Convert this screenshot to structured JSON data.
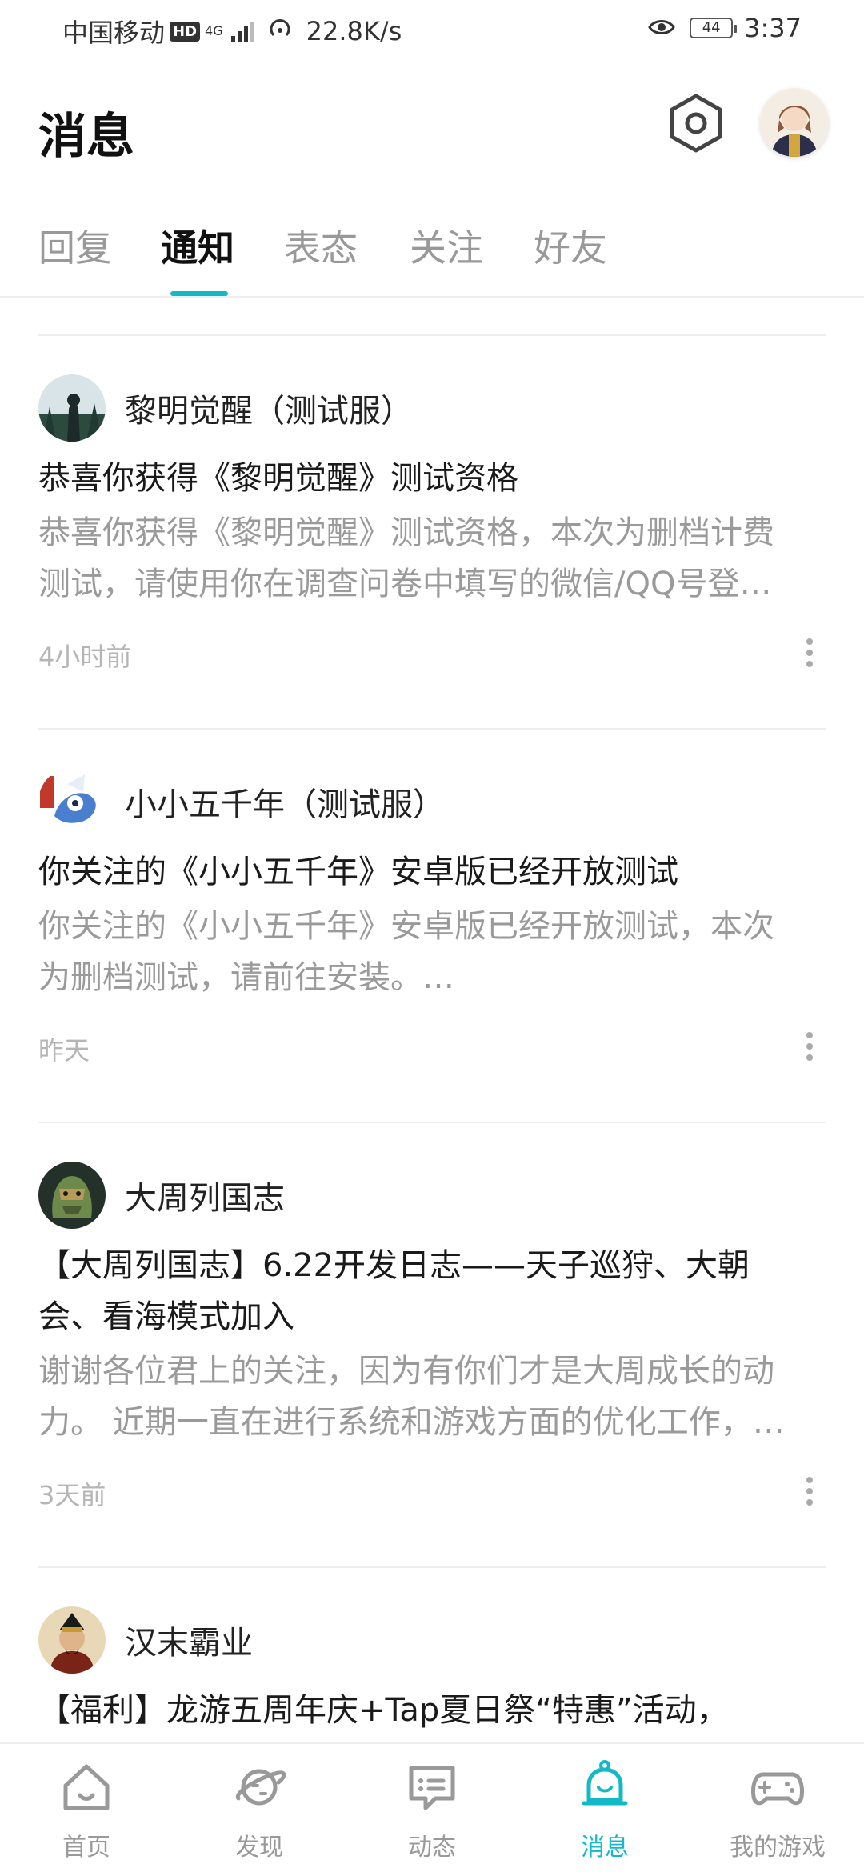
{
  "status_bar": {
    "carrier": "中国移动",
    "hd": "HD",
    "network": "4G",
    "speed": "22.8K/s",
    "battery": "44",
    "time": "3:37"
  },
  "header": {
    "title": "消息",
    "settings_icon": "hexagon-settings-icon",
    "avatar_icon": "user-avatar"
  },
  "tabs": [
    {
      "label": "回复",
      "active": false
    },
    {
      "label": "通知",
      "active": true
    },
    {
      "label": "表态",
      "active": false
    },
    {
      "label": "关注",
      "active": false
    },
    {
      "label": "好友",
      "active": false
    }
  ],
  "accent_color": "#14b9c8",
  "notifications": [
    {
      "source": "黎明觉醒（测试服）",
      "title": "恭喜你获得《黎明觉醒》测试资格",
      "body_line1": "恭喜你获得《黎明觉醒》测试资格，本次为删档计费",
      "body_line2": "测试，请使用你在调查问卷中填写的微信/QQ号登…",
      "time": "4小时前"
    },
    {
      "source": "小小五千年（测试服）",
      "title": "你关注的《小小五千年》安卓版已经开放测试",
      "body_line1": "你关注的《小小五千年》安卓版已经开放测试，本次",
      "body_line2": "为删档测试，请前往安装。…",
      "time": "昨天"
    },
    {
      "source": "大周列国志",
      "title_line1": "【大周列国志】6.22开发日志——天子巡狩、大朝",
      "title_line2": "会、看海模式加入",
      "body_line1": "谢谢各位君上的关注，因为有你们才是大周成长的动",
      "body_line2": "力。 近期一直在进行系统和游戏方面的优化工作，…",
      "time": "3天前"
    },
    {
      "source": "汉末霸业",
      "title": "【福利】龙游五周年庆+Tap夏日祭“特惠”活动，"
    }
  ],
  "bottom_nav": [
    {
      "label": "首页",
      "icon": "home-icon",
      "active": false
    },
    {
      "label": "发现",
      "icon": "planet-icon",
      "active": false
    },
    {
      "label": "动态",
      "icon": "message-board-icon",
      "active": false
    },
    {
      "label": "消息",
      "icon": "bell-icon",
      "active": true
    },
    {
      "label": "我的游戏",
      "icon": "gamepad-icon",
      "active": false
    }
  ]
}
